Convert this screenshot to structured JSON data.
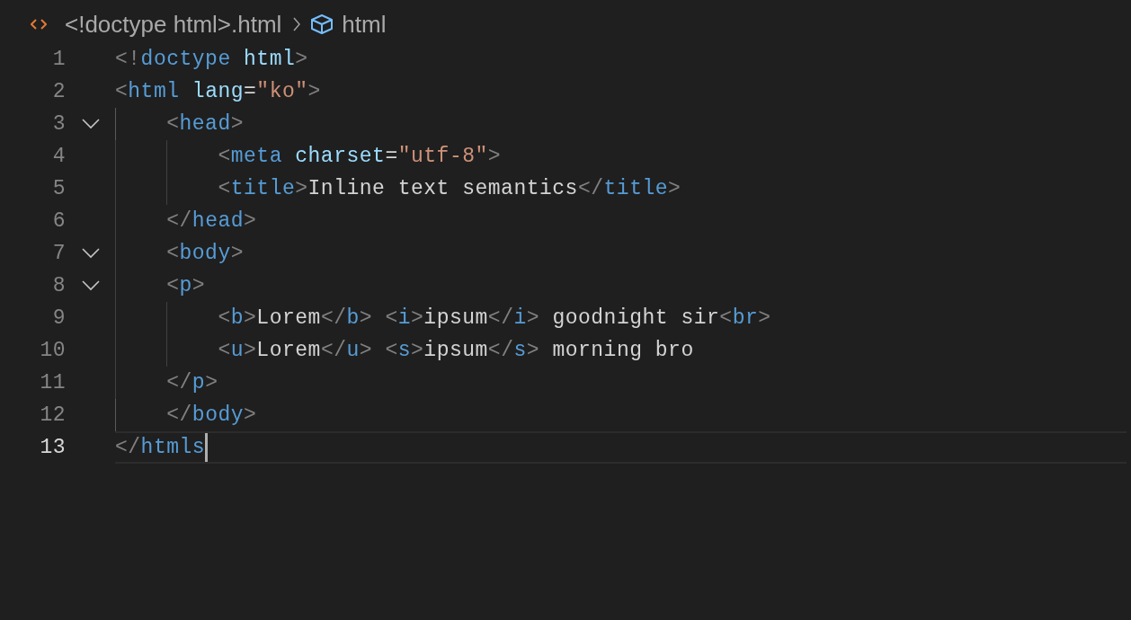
{
  "breadcrumb": {
    "file": "<!doctype html>.html",
    "symbol": "html"
  },
  "lines": [
    {
      "number": "1",
      "tokens": [
        {
          "kind": "punct",
          "text": "<!"
        },
        {
          "kind": "tag",
          "text": "doctype"
        },
        {
          "kind": "attr",
          "text": " html"
        },
        {
          "kind": "punct",
          "text": ">"
        }
      ]
    },
    {
      "number": "2",
      "tokens": [
        {
          "kind": "punct",
          "text": "<"
        },
        {
          "kind": "tag",
          "text": "html"
        },
        {
          "kind": "attr",
          "text": " lang"
        },
        {
          "kind": "text",
          "text": "="
        },
        {
          "kind": "string",
          "text": "\"ko\""
        },
        {
          "kind": "punct",
          "text": ">"
        }
      ]
    },
    {
      "number": "3",
      "expanded": true,
      "tokens": [
        {
          "kind": "punct",
          "text": "    <"
        },
        {
          "kind": "tag",
          "text": "head"
        },
        {
          "kind": "punct",
          "text": ">"
        }
      ]
    },
    {
      "number": "4",
      "tokens": [
        {
          "kind": "punct",
          "text": "        <"
        },
        {
          "kind": "tag",
          "text": "meta"
        },
        {
          "kind": "attr",
          "text": " charset"
        },
        {
          "kind": "text",
          "text": "="
        },
        {
          "kind": "string",
          "text": "\"utf-8\""
        },
        {
          "kind": "punct",
          "text": ">"
        }
      ]
    },
    {
      "number": "5",
      "tokens": [
        {
          "kind": "punct",
          "text": "        <"
        },
        {
          "kind": "tag",
          "text": "title"
        },
        {
          "kind": "punct",
          "text": ">"
        },
        {
          "kind": "text",
          "text": "Inline text semantics"
        },
        {
          "kind": "punct",
          "text": "</"
        },
        {
          "kind": "tag",
          "text": "title"
        },
        {
          "kind": "punct",
          "text": ">"
        }
      ]
    },
    {
      "number": "6",
      "tokens": [
        {
          "kind": "punct",
          "text": "    </"
        },
        {
          "kind": "tag",
          "text": "head"
        },
        {
          "kind": "punct",
          "text": ">"
        }
      ]
    },
    {
      "number": "7",
      "expanded": true,
      "tokens": [
        {
          "kind": "punct",
          "text": "    <"
        },
        {
          "kind": "tag",
          "text": "body"
        },
        {
          "kind": "punct",
          "text": ">"
        }
      ]
    },
    {
      "number": "8",
      "expanded": true,
      "tokens": [
        {
          "kind": "punct",
          "text": "    <"
        },
        {
          "kind": "tag",
          "text": "p"
        },
        {
          "kind": "punct",
          "text": ">"
        }
      ]
    },
    {
      "number": "9",
      "tokens": [
        {
          "kind": "punct",
          "text": "        <"
        },
        {
          "kind": "tag",
          "text": "b"
        },
        {
          "kind": "punct",
          "text": ">"
        },
        {
          "kind": "text",
          "text": "Lorem"
        },
        {
          "kind": "punct",
          "text": "</"
        },
        {
          "kind": "tag",
          "text": "b"
        },
        {
          "kind": "punct",
          "text": "> <"
        },
        {
          "kind": "tag",
          "text": "i"
        },
        {
          "kind": "punct",
          "text": ">"
        },
        {
          "kind": "text",
          "text": "ipsum"
        },
        {
          "kind": "punct",
          "text": "</"
        },
        {
          "kind": "tag",
          "text": "i"
        },
        {
          "kind": "punct",
          "text": ">"
        },
        {
          "kind": "text",
          "text": " goodnight sir"
        },
        {
          "kind": "punct",
          "text": "<"
        },
        {
          "kind": "tag",
          "text": "br"
        },
        {
          "kind": "punct",
          "text": ">"
        }
      ]
    },
    {
      "number": "10",
      "tokens": [
        {
          "kind": "punct",
          "text": "        <"
        },
        {
          "kind": "tag",
          "text": "u"
        },
        {
          "kind": "punct",
          "text": ">"
        },
        {
          "kind": "text",
          "text": "Lorem"
        },
        {
          "kind": "punct",
          "text": "</"
        },
        {
          "kind": "tag",
          "text": "u"
        },
        {
          "kind": "punct",
          "text": "> <"
        },
        {
          "kind": "tag",
          "text": "s"
        },
        {
          "kind": "punct",
          "text": ">"
        },
        {
          "kind": "text",
          "text": "ipsum"
        },
        {
          "kind": "punct",
          "text": "</"
        },
        {
          "kind": "tag",
          "text": "s"
        },
        {
          "kind": "punct",
          "text": ">"
        },
        {
          "kind": "text",
          "text": " morning bro"
        }
      ]
    },
    {
      "number": "11",
      "tokens": [
        {
          "kind": "punct",
          "text": "    </"
        },
        {
          "kind": "tag",
          "text": "p"
        },
        {
          "kind": "punct",
          "text": ">"
        }
      ]
    },
    {
      "number": "12",
      "tokens": [
        {
          "kind": "punct",
          "text": "    </"
        },
        {
          "kind": "tag",
          "text": "body"
        },
        {
          "kind": "punct",
          "text": ">"
        }
      ]
    },
    {
      "number": "13",
      "current": true,
      "tokens": [
        {
          "kind": "punct",
          "text": "</"
        },
        {
          "kind": "tag",
          "text": "htmls"
        }
      ]
    }
  ]
}
